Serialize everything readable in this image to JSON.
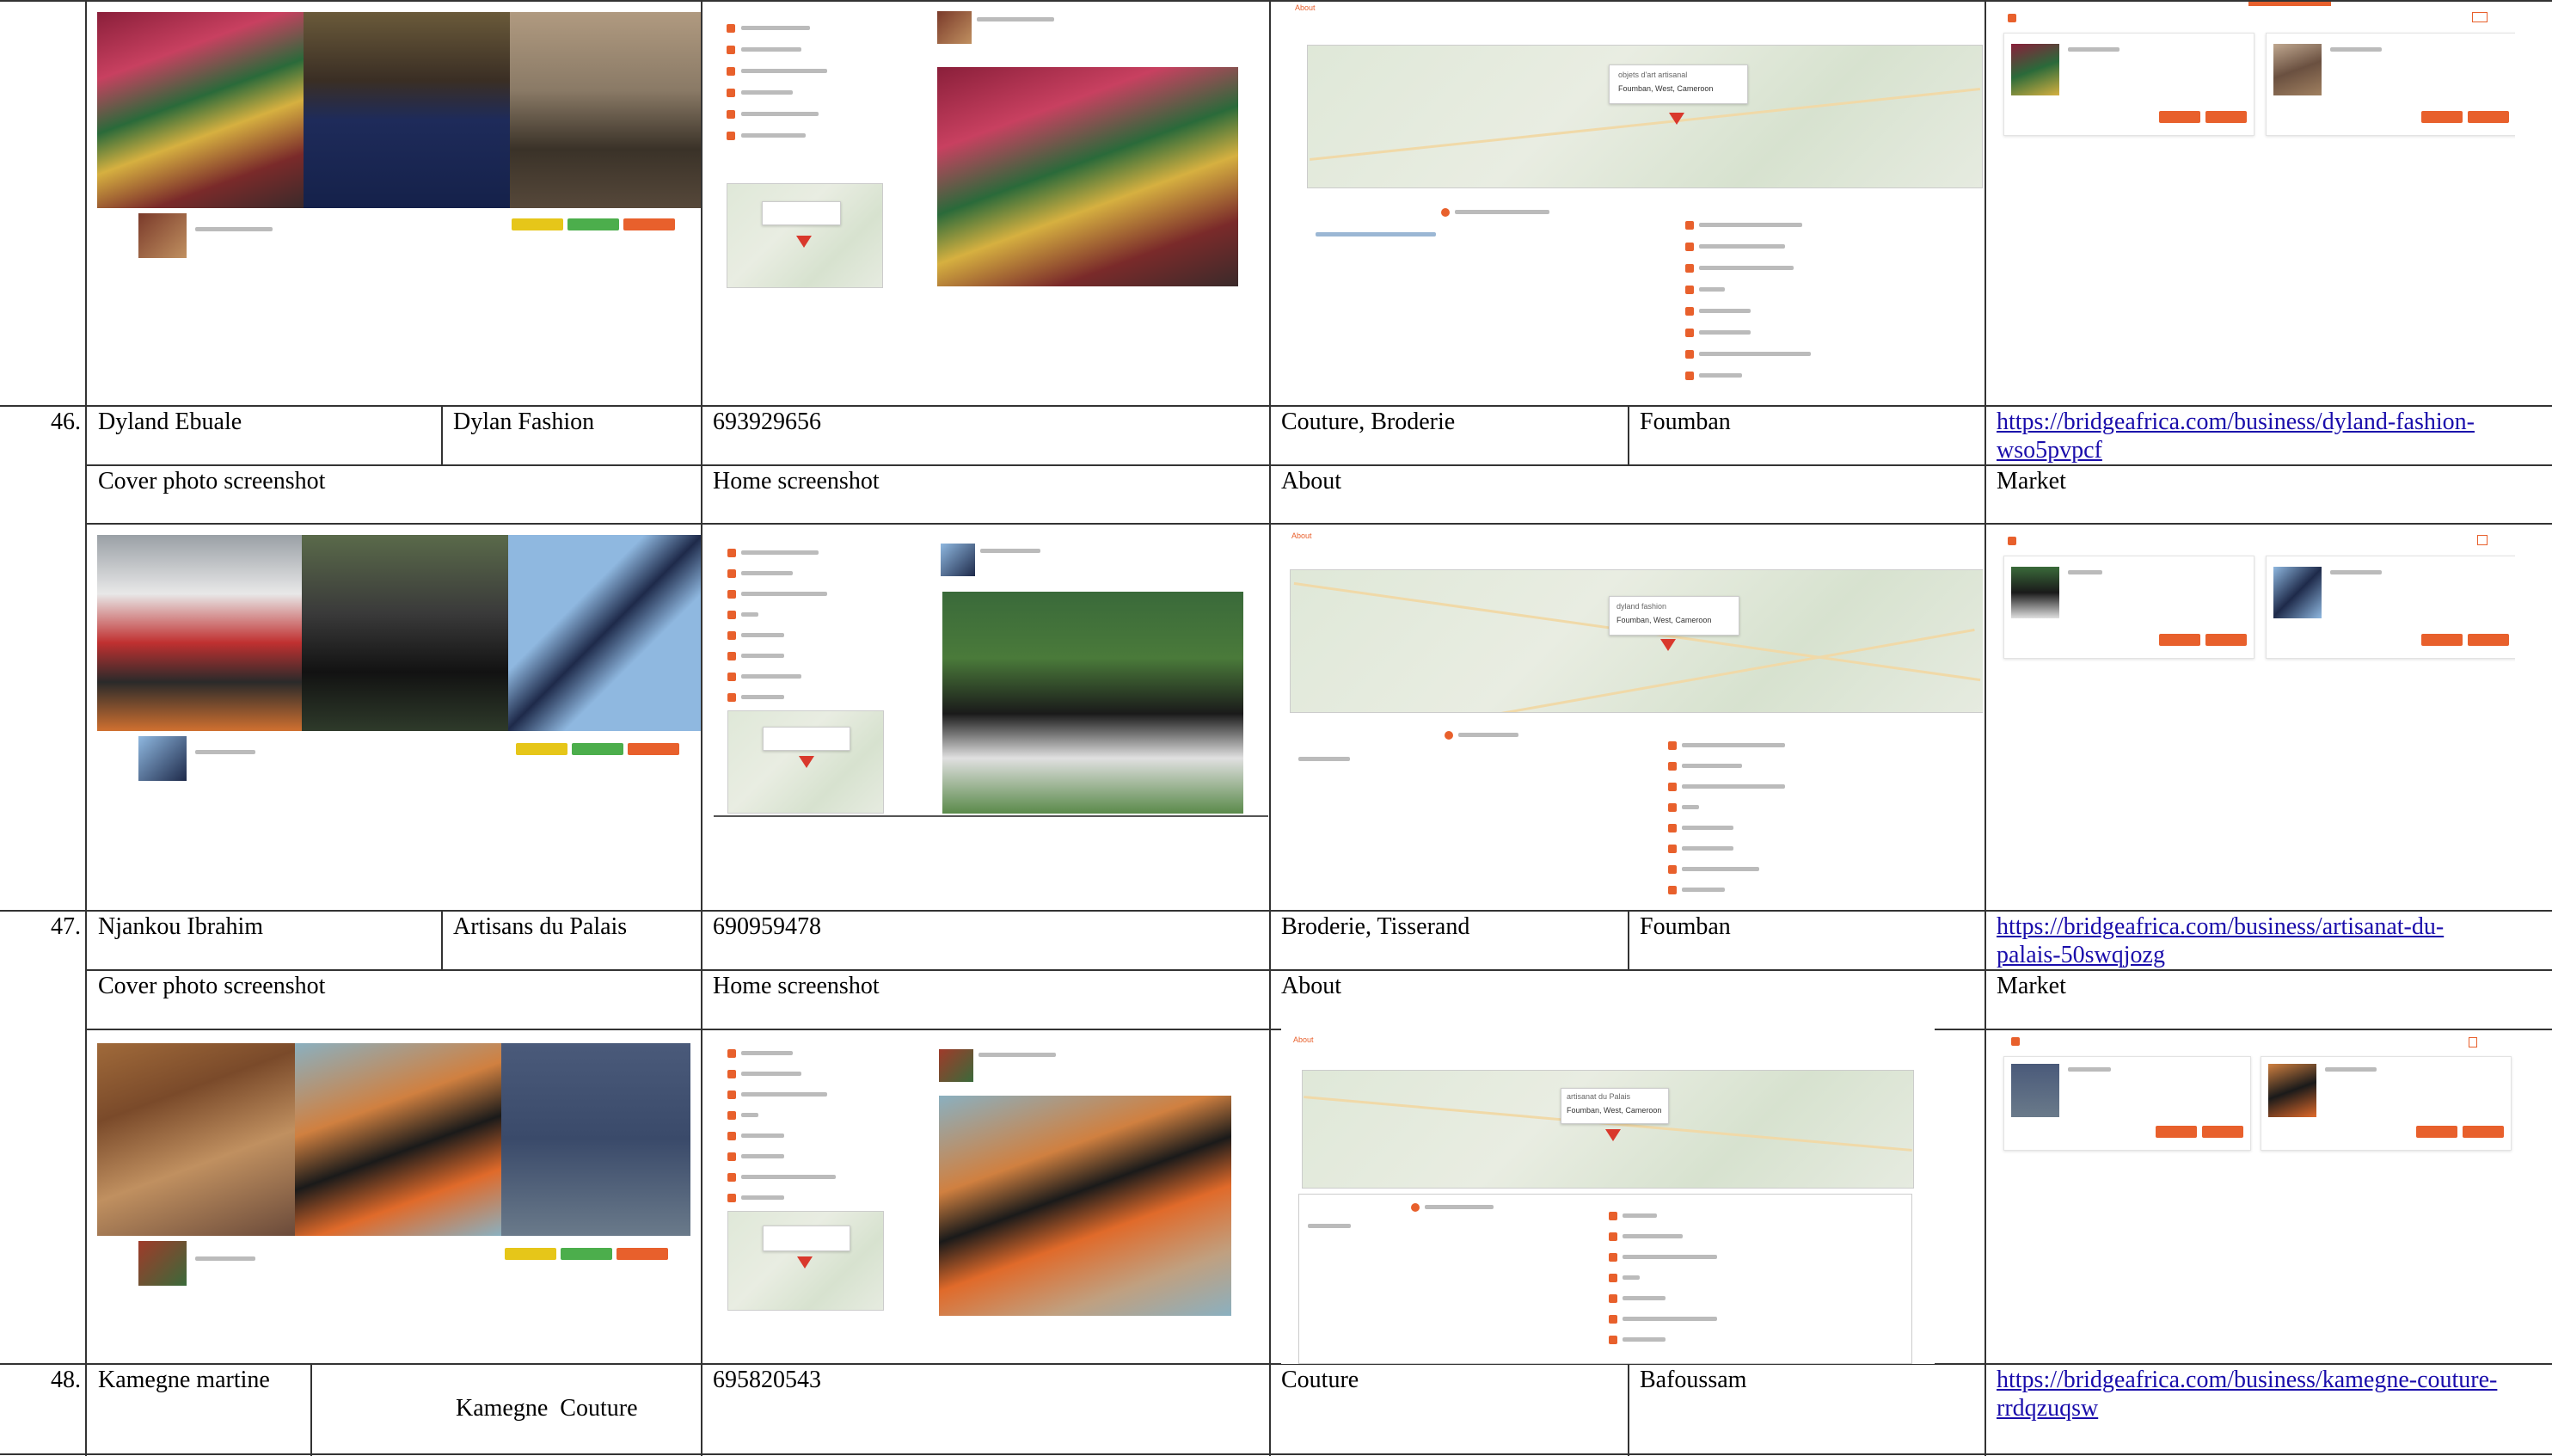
{
  "rows": [
    {
      "number": "46.",
      "name": "Dyland Ebuale",
      "business": "Dylan Fashion",
      "phone": "693929656",
      "activity": "Couture, Broderie",
      "city": "Foumban",
      "url_line1": "https://bridgeafrica.com/business/dyland-fashion-",
      "url_line2": "wso5pvpcf"
    },
    {
      "number": "47.",
      "name": "Njankou Ibrahim",
      "business": "Artisans du Palais",
      "phone": "690959478",
      "activity": "Broderie, Tisserand",
      "city": "Foumban",
      "url_line1": "https://bridgeafrica.com/business/artisanat-du-",
      "url_line2": "palais-50swqjozg"
    },
    {
      "number": "48.",
      "name": "Kamegne martine",
      "business": "Kamegne  Couture",
      "phone": "695820543",
      "activity": "Couture",
      "city": "Bafoussam",
      "url_line1": "https://bridgeafrica.com/business/kamegne-couture-",
      "url_line2": "rrdqzuqsw"
    }
  ],
  "section_headers": {
    "cover": "Cover photo screenshot",
    "home": "Home screenshot",
    "about": "About",
    "market": "Market"
  },
  "screenshots": {
    "about_label": "About",
    "row0_business": "objets d'art artisanal",
    "row0_location": "Foumban, West, Cameroon",
    "row1_business": "dyland fashion",
    "row1_location": "Foumban, West, Cameroon",
    "row2_business": "artisanat du Palais",
    "row2_location": "Foumban, West, Cameroon"
  },
  "colors": {
    "accent": "#e8602c",
    "link": "#1a0dab",
    "grid": "#333333"
  }
}
